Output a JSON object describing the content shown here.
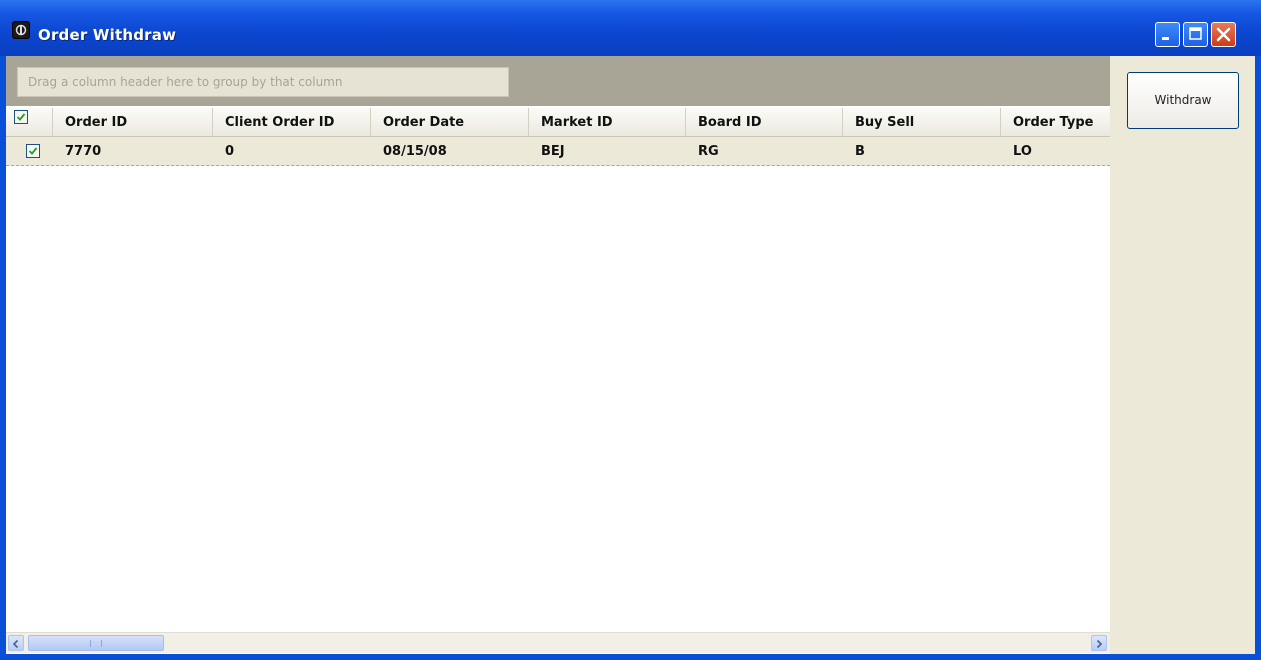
{
  "window": {
    "title": "Order Withdraw"
  },
  "grid": {
    "group_hint": "Drag a column header here to group by that column",
    "columns": [
      "Order ID",
      "Client Order ID",
      "Order Date",
      "Market ID",
      "Board ID",
      "Buy Sell",
      "Order Type"
    ],
    "rows": [
      {
        "checked": true,
        "cells": [
          "7770",
          "0",
          "08/15/08",
          "BEJ",
          "RG",
          "B",
          "LO"
        ]
      }
    ]
  },
  "actions": {
    "withdraw_label": "Withdraw"
  },
  "colors": {
    "titlebar": "#0a4fd8",
    "client": "#ece9d8",
    "group_panel": "#a8a597"
  }
}
